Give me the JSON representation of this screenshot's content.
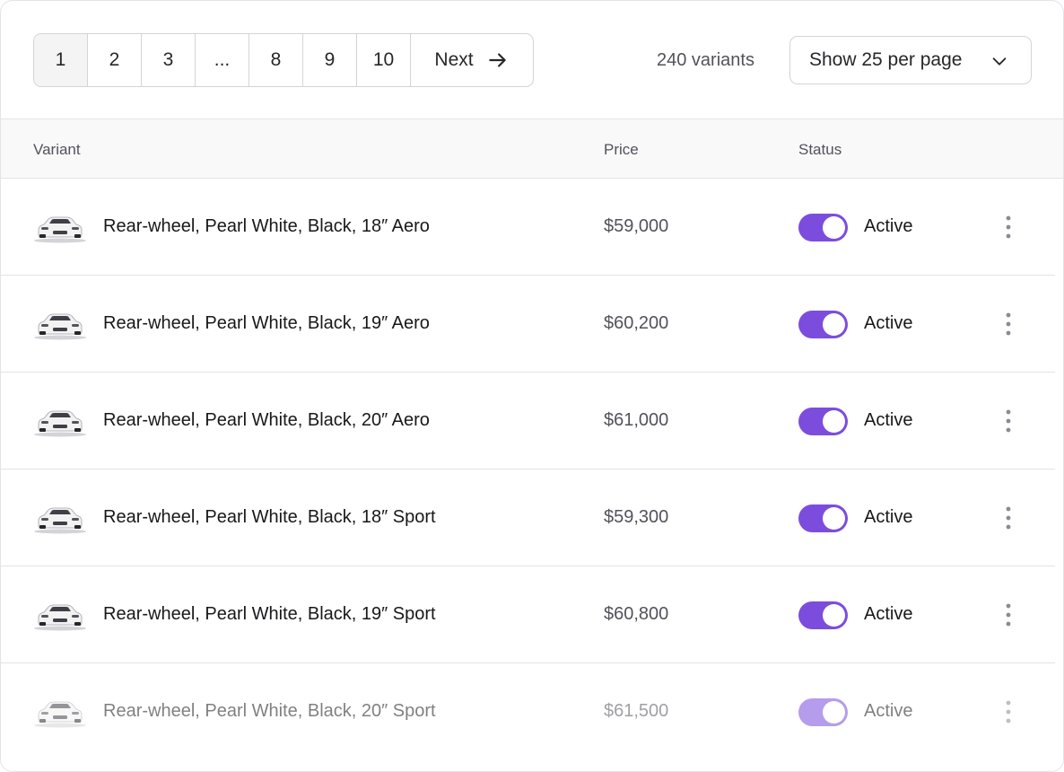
{
  "pagination": {
    "pages": [
      "1",
      "2",
      "3",
      "...",
      "8",
      "9",
      "10"
    ],
    "current": "1",
    "next_label": "Next"
  },
  "summary": {
    "count_label": "240 variants"
  },
  "per_page": {
    "label": "Show 25 per page"
  },
  "table": {
    "columns": {
      "variant": "Variant",
      "price": "Price",
      "status": "Status"
    },
    "rows": [
      {
        "name": "Rear-wheel, Pearl White, Black, 18″ Aero",
        "price": "$59,000",
        "status": "Active",
        "active": true
      },
      {
        "name": "Rear-wheel, Pearl White, Black, 19″ Aero",
        "price": "$60,200",
        "status": "Active",
        "active": true
      },
      {
        "name": "Rear-wheel, Pearl White, Black, 20″ Aero",
        "price": "$61,000",
        "status": "Active",
        "active": true
      },
      {
        "name": "Rear-wheel, Pearl White, Black, 18″ Sport",
        "price": "$59,300",
        "status": "Active",
        "active": true
      },
      {
        "name": "Rear-wheel, Pearl White, Black, 19″ Sport",
        "price": "$60,800",
        "status": "Active",
        "active": true
      },
      {
        "name": "Rear-wheel, Pearl White, Black, 20″ Sport",
        "price": "$61,500",
        "status": "Active",
        "active": true
      }
    ]
  },
  "colors": {
    "toggle_on": "#7c4ddd",
    "border": "#e4e4e7",
    "header_bg": "#f9f9fa"
  },
  "icons": {
    "next": "arrow-right-icon",
    "dropdown": "chevron-down-icon",
    "row_menu": "more-vertical-icon",
    "thumbnail": "car-thumbnail"
  }
}
